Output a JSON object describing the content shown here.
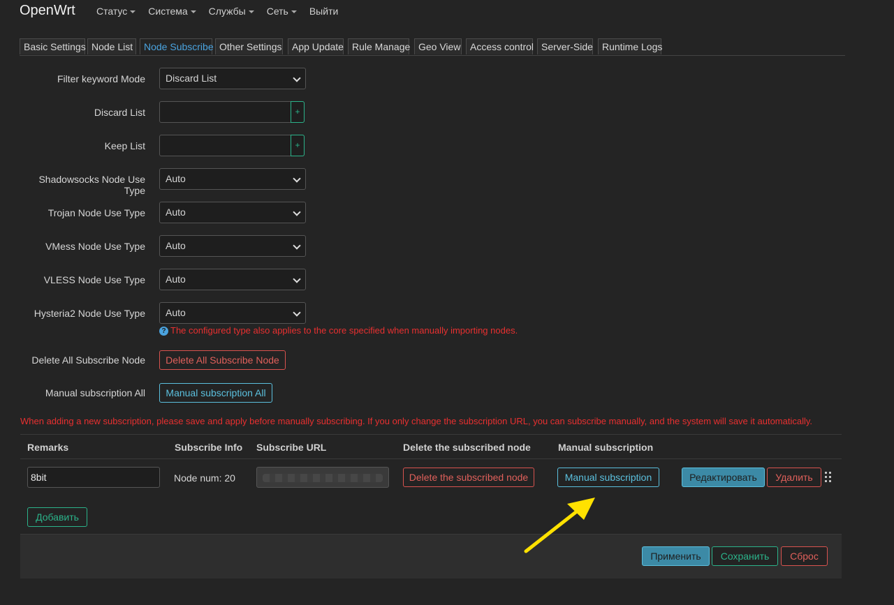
{
  "header": {
    "brand": "OpenWrt",
    "menu": [
      {
        "label": "Статус"
      },
      {
        "label": "Система"
      },
      {
        "label": "Службы"
      },
      {
        "label": "Сеть"
      },
      {
        "label": "Выйти"
      }
    ]
  },
  "tabs": [
    {
      "label": "Basic Settings"
    },
    {
      "label": "Node List"
    },
    {
      "label": "Node Subscribe",
      "active": true
    },
    {
      "label": "Other Settings"
    },
    {
      "label": "App Update"
    },
    {
      "label": "Rule Manage"
    },
    {
      "label": "Geo View"
    },
    {
      "label": "Access control"
    },
    {
      "label": "Server-Side"
    },
    {
      "label": "Runtime Logs"
    }
  ],
  "form": {
    "filter_mode": {
      "label": "Filter keyword Mode",
      "value": "Discard List"
    },
    "discard_list": {
      "label": "Discard List",
      "value": "",
      "add": "+"
    },
    "keep_list": {
      "label": "Keep List",
      "value": "",
      "add": "+"
    },
    "ss_type": {
      "label": "Shadowsocks Node Use Type",
      "value": "Auto"
    },
    "trojan_type": {
      "label": "Trojan Node Use Type",
      "value": "Auto"
    },
    "vmess_type": {
      "label": "VMess Node Use Type",
      "value": "Auto"
    },
    "vless_type": {
      "label": "VLESS Node Use Type",
      "value": "Auto"
    },
    "hy2_type": {
      "label": "Hysteria2 Node Use Type",
      "value": "Auto"
    },
    "hint": "The configured type also applies to the core specified when manually importing nodes.",
    "delete_all": {
      "label": "Delete All Subscribe Node",
      "button": "Delete All Subscribe Node"
    },
    "manual_all": {
      "label": "Manual subscription All",
      "button": "Manual subscription All"
    }
  },
  "warning": "When adding a new subscription, please save and apply before manually subscribing. If you only change the subscription URL, you can subscribe manually, and the system will save it automatically.",
  "table": {
    "headers": {
      "remarks": "Remarks",
      "info": "Subscribe Info",
      "url": "Subscribe URL",
      "delete": "Delete the subscribed node",
      "manual": "Manual subscription"
    },
    "rows": [
      {
        "remarks": "8bit",
        "info": "Node num: 20",
        "delete_button": "Delete the subscribed node",
        "manual_button": "Manual subscription",
        "edit_button": "Редактировать",
        "remove_button": "Удалить"
      }
    ],
    "add_button": "Добавить"
  },
  "actions": {
    "apply": "Применить",
    "save": "Сохранить",
    "reset": "Сброс"
  },
  "colors": {
    "background": "#242424",
    "accent_blue": "#5bc0de",
    "danger": "#d9534f",
    "success": "#2bb38a",
    "annotation_arrow": "#ffe100"
  }
}
